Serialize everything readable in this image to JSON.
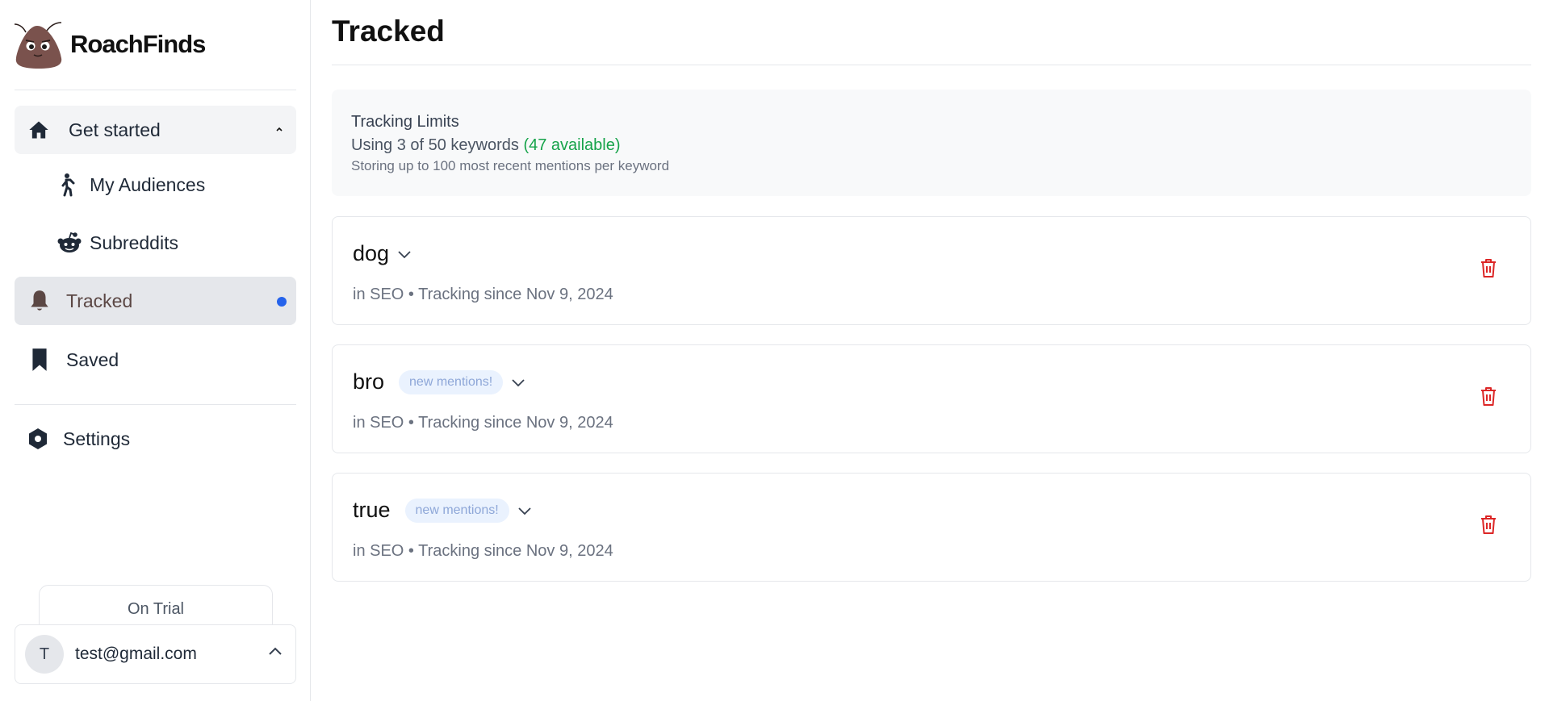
{
  "app": {
    "name": "RoachFinds"
  },
  "sidebar": {
    "get_started": {
      "label": "Get started",
      "icon": "home-icon",
      "expanded": true
    },
    "sub_items": [
      {
        "label": "My Audiences",
        "icon": "person-walking-icon"
      },
      {
        "label": "Subreddits",
        "icon": "reddit-icon"
      }
    ],
    "tracked": {
      "label": "Tracked",
      "icon": "bell-icon",
      "active": true,
      "indicator_color": "#2563eb"
    },
    "saved": {
      "label": "Saved",
      "icon": "bookmark-icon"
    },
    "settings": {
      "label": "Settings",
      "icon": "hexagon-gear-icon"
    },
    "plan": {
      "label": "On Trial"
    },
    "user": {
      "initial": "T",
      "email": "test@gmail.com"
    }
  },
  "main": {
    "title": "Tracked",
    "limits": {
      "title": "Tracking Limits",
      "usage": "Using 3 of 50 keywords",
      "available": "(47 available)",
      "note": "Storing up to 100 most recent mentions per keyword"
    },
    "keywords": [
      {
        "keyword": "dog",
        "badge": "",
        "meta": "in SEO • Tracking since Nov 9, 2024"
      },
      {
        "keyword": "bro",
        "badge": "new mentions!",
        "meta": "in SEO • Tracking since Nov 9, 2024"
      },
      {
        "keyword": "true",
        "badge": "new mentions!",
        "meta": "in SEO • Tracking since Nov 9, 2024"
      }
    ]
  },
  "colors": {
    "accent": "#2563eb",
    "available_green": "#16a34a",
    "trash_red": "#dc2626",
    "badge_bg": "#eaf2fe",
    "brand_brown": "#7a524d"
  }
}
